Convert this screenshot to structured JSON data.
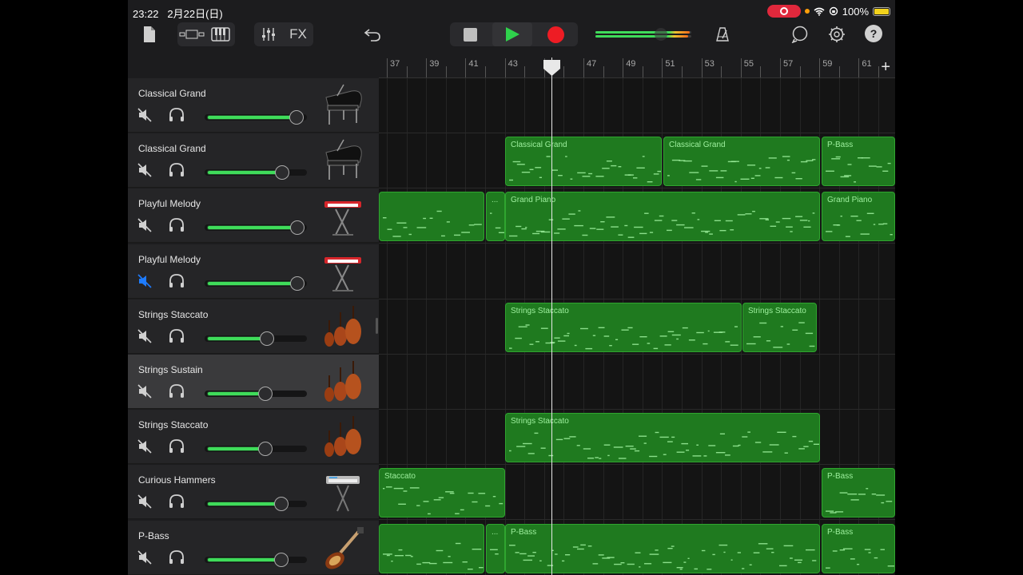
{
  "status_bar": {
    "time": "23:22",
    "date": "2月22日(日)",
    "battery": "100%"
  },
  "toolbar": {
    "fx_label": "FX"
  },
  "ruler": {
    "bar_numbers": [
      "37",
      "39",
      "41",
      "43",
      "45",
      "47",
      "49",
      "51",
      "53",
      "55",
      "57",
      "59",
      "61"
    ],
    "playhead_bar": "45",
    "add_label": "+"
  },
  "tracks": [
    {
      "name": "Classical Grand",
      "volume": 0.92,
      "muted": false,
      "instrument": "grand-piano-icon",
      "regions": []
    },
    {
      "name": "Classical Grand",
      "volume": 0.78,
      "muted": false,
      "instrument": "grand-piano-icon",
      "regions": [
        {
          "label": "Classical Grand"
        },
        {
          "label": "Classical Grand"
        },
        {
          "label": "P-Bass"
        }
      ]
    },
    {
      "name": "Playful Melody",
      "volume": 0.93,
      "muted": false,
      "instrument": "keyboard-stand-icon",
      "regions": [
        {
          "label": ""
        },
        {
          "label": "..."
        },
        {
          "label": "Grand Piano"
        },
        {
          "label": "Grand Piano"
        }
      ]
    },
    {
      "name": "Playful Melody",
      "volume": 0.93,
      "muted": true,
      "instrument": "keyboard-stand-icon",
      "regions": []
    },
    {
      "name": "Strings Staccato",
      "volume": 0.63,
      "muted": false,
      "instrument": "strings-icon",
      "regions": [
        {
          "label": "Strings Staccato"
        },
        {
          "label": "Strings Staccato"
        }
      ]
    },
    {
      "name": "Strings Sustain",
      "volume": 0.62,
      "muted": false,
      "instrument": "strings-icon",
      "regions": []
    },
    {
      "name": "Strings Staccato",
      "volume": 0.62,
      "muted": false,
      "instrument": "strings-icon",
      "regions": [
        {
          "label": "Strings Staccato"
        }
      ]
    },
    {
      "name": "Curious Hammers",
      "volume": 0.77,
      "muted": false,
      "instrument": "synth-stand-icon",
      "regions": [
        {
          "label": "Staccato"
        },
        {
          "label": "P-Bass"
        }
      ]
    },
    {
      "name": "P-Bass",
      "volume": 0.77,
      "muted": false,
      "instrument": "bass-guitar-icon",
      "regions": [
        {
          "label": ""
        },
        {
          "label": "..."
        },
        {
          "label": "P-Bass"
        },
        {
          "label": "P-Bass"
        }
      ]
    }
  ],
  "colors": {
    "region_green": "#1f7a1f",
    "meter_green": "#3fdc5a",
    "record_red": "#ee1c24",
    "play_green": "#2fd24c",
    "mute_active_blue": "#1e7cff"
  }
}
